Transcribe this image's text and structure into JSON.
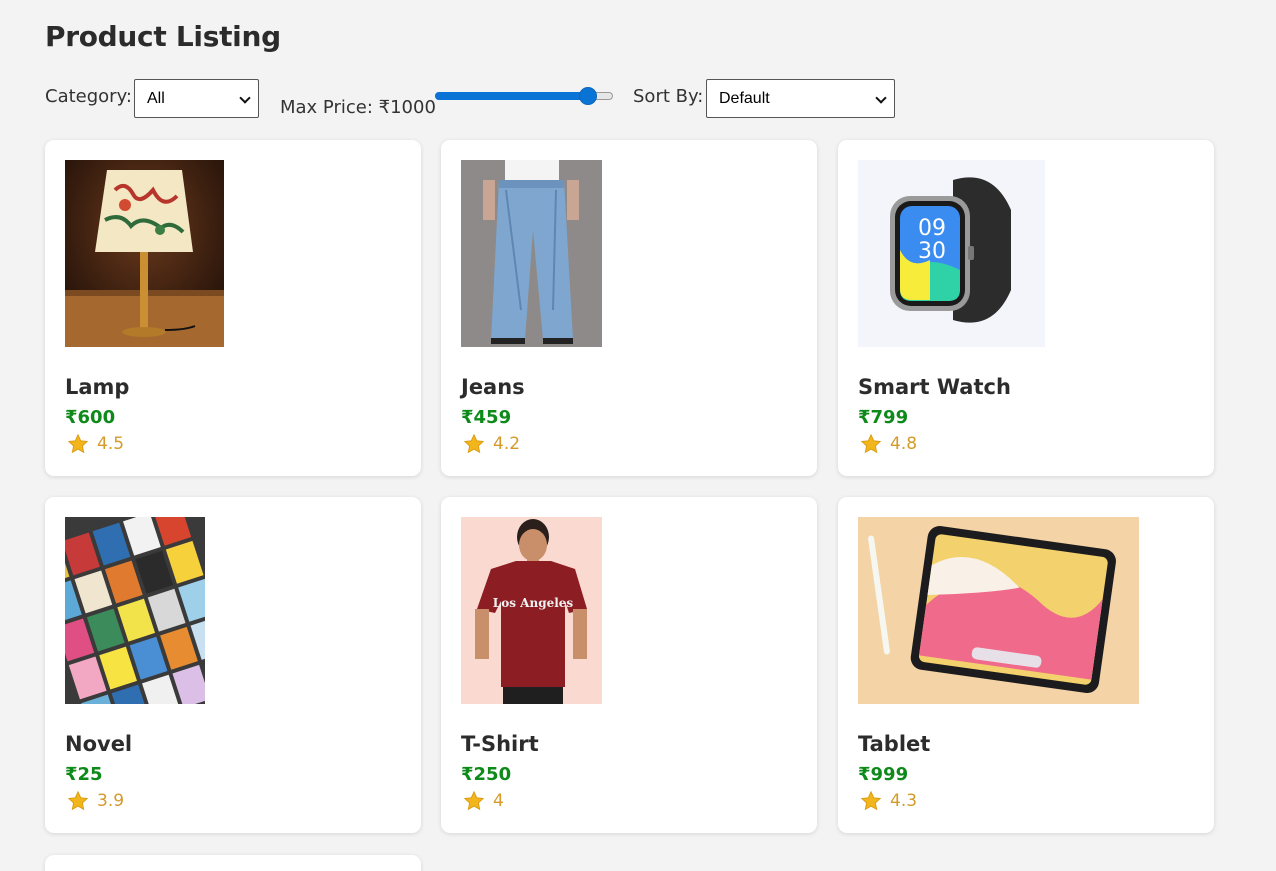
{
  "page": {
    "title": "Product Listing"
  },
  "filters": {
    "category_label": "Category:",
    "category_value": "All",
    "price_label": "Max Price: ₹1000",
    "price_fraction": 0.9,
    "sort_label": "Sort By:",
    "sort_value": "Default"
  },
  "colors": {
    "accent": "#0a74d6",
    "price": "#0e8a1a",
    "rating": "#d49a2a"
  },
  "products": [
    {
      "name": "Lamp",
      "price": "₹600",
      "rating": "4.5",
      "image": "lamp-photo"
    },
    {
      "name": "Jeans",
      "price": "₹459",
      "rating": "4.2",
      "image": "jeans-photo"
    },
    {
      "name": "Smart Watch",
      "price": "₹799",
      "rating": "4.8",
      "image": "smartwatch-photo"
    },
    {
      "name": "Novel",
      "price": "₹25",
      "rating": "3.9",
      "image": "books-photo"
    },
    {
      "name": "T-Shirt",
      "price": "₹250",
      "rating": "4",
      "image": "tshirt-photo"
    },
    {
      "name": "Tablet",
      "price": "₹999",
      "rating": "4.3",
      "image": "tablet-photo"
    }
  ]
}
